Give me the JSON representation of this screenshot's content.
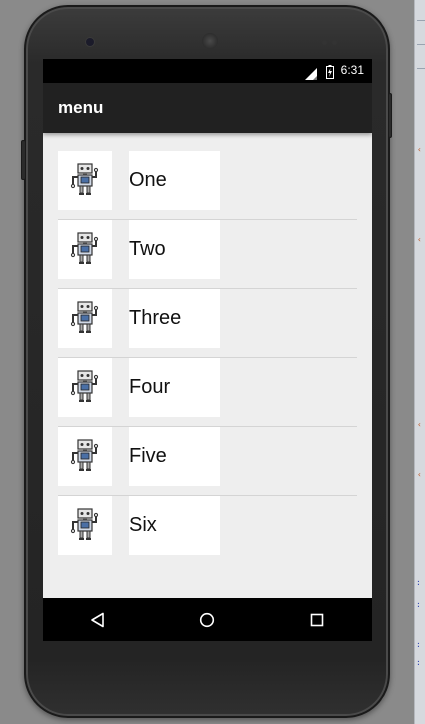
{
  "status_bar": {
    "time": "6:31",
    "signal_icon": "signal-icon",
    "battery_icon": "battery-charging-icon"
  },
  "app_bar": {
    "title": "menu"
  },
  "list": {
    "items": [
      {
        "label": "One",
        "icon": "robot-icon"
      },
      {
        "label": "Two",
        "icon": "robot-icon"
      },
      {
        "label": "Three",
        "icon": "robot-icon"
      },
      {
        "label": "Four",
        "icon": "robot-icon"
      },
      {
        "label": "Five",
        "icon": "robot-icon"
      },
      {
        "label": "Six",
        "icon": "robot-icon"
      }
    ]
  },
  "nav_bar": {
    "back_icon": "back-triangle-icon",
    "home_icon": "home-circle-icon",
    "recents_icon": "recents-square-icon"
  },
  "colors": {
    "app_bar": "#212121",
    "status_bar": "#000000",
    "list_background": "#eeeeee",
    "item_background": "#ffffff",
    "robot_body": "#4a6fa5"
  }
}
